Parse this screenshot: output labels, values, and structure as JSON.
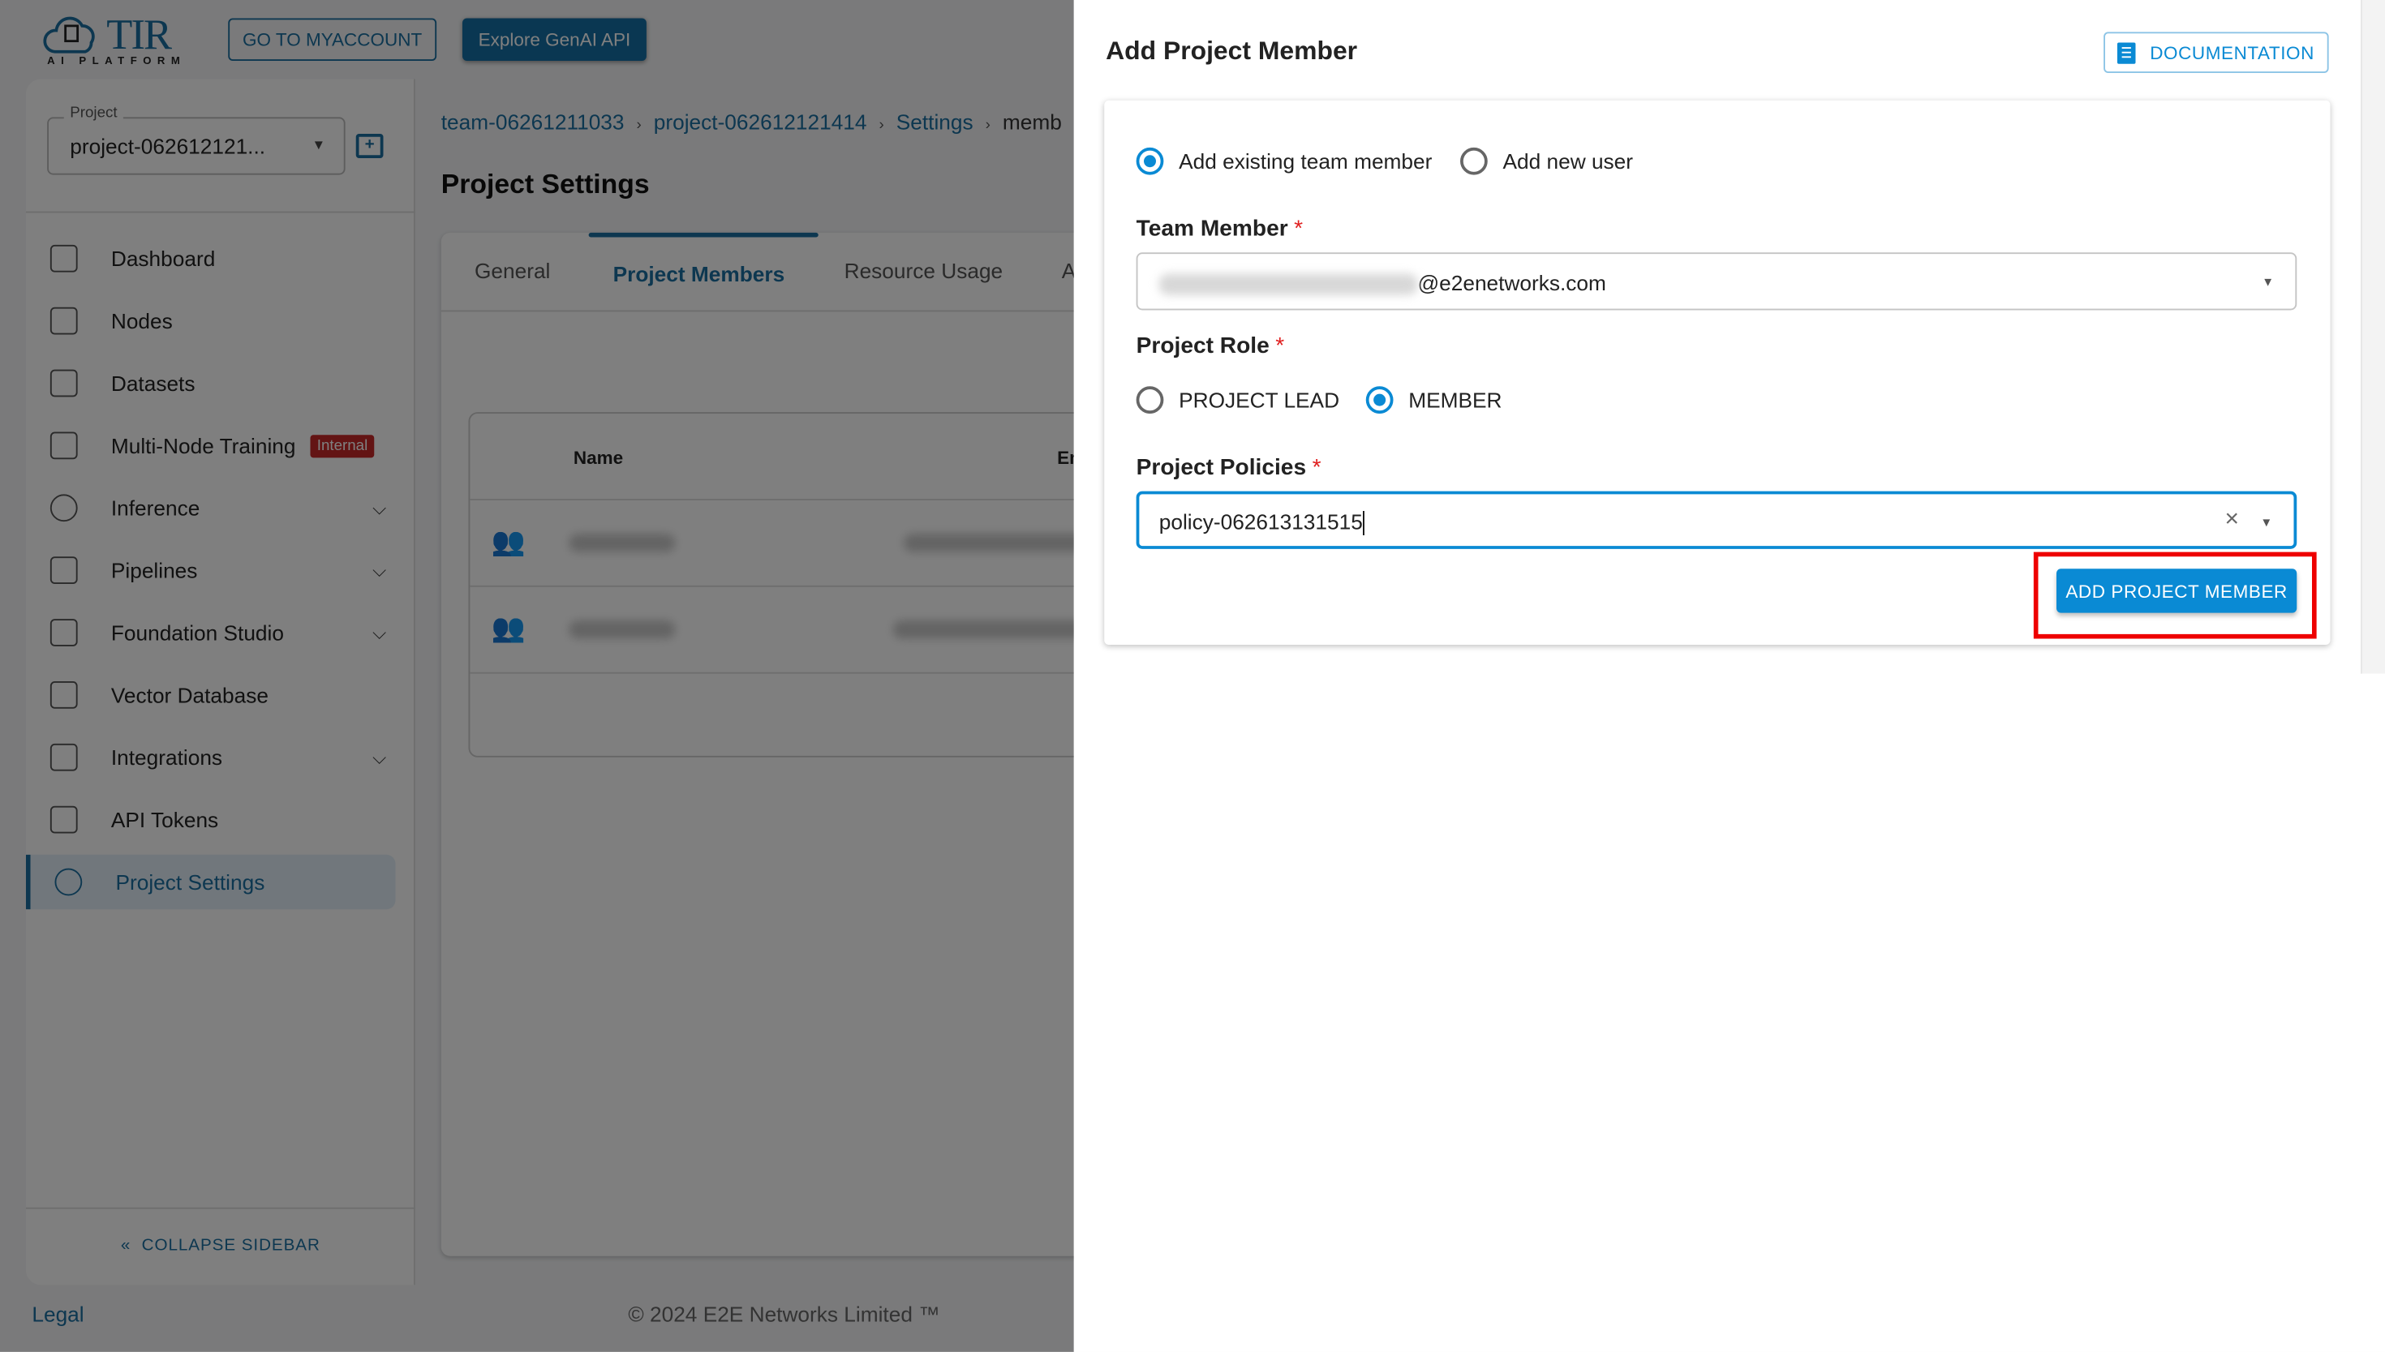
{
  "header": {
    "logo_text": "TIR",
    "logo_sub": "AI PLATFORM",
    "myaccount_label": "GO TO MYACCOUNT",
    "genai_label": "Explore GenAI API"
  },
  "sidebar": {
    "project_label": "Project",
    "project_value": "project-062612121...",
    "items": [
      {
        "label": "Dashboard",
        "icon": "dashboard-icon"
      },
      {
        "label": "Nodes",
        "icon": "file-icon"
      },
      {
        "label": "Datasets",
        "icon": "dataset-icon"
      },
      {
        "label": "Multi-Node Training",
        "icon": "training-icon",
        "badge": "Internal"
      },
      {
        "label": "Inference",
        "icon": "inference-icon",
        "expandable": true
      },
      {
        "label": "Pipelines",
        "icon": "pipeline-icon",
        "expandable": true
      },
      {
        "label": "Foundation Studio",
        "icon": "studio-icon",
        "expandable": true
      },
      {
        "label": "Vector Database",
        "icon": "vector-icon"
      },
      {
        "label": "Integrations",
        "icon": "integration-icon",
        "expandable": true
      },
      {
        "label": "API Tokens",
        "icon": "token-icon"
      },
      {
        "label": "Project Settings",
        "icon": "gear-icon",
        "active": true
      }
    ],
    "collapse_label": "COLLAPSE SIDEBAR"
  },
  "breadcrumb": [
    "team-06261211033",
    "project-062612121414",
    "Settings",
    "memb"
  ],
  "page_title": "Project Settings",
  "tabs": [
    {
      "label": "General"
    },
    {
      "label": "Project Members",
      "active": true
    },
    {
      "label": "Resource Usage"
    },
    {
      "label": "A"
    }
  ],
  "table": {
    "columns": [
      "Name",
      "Em"
    ]
  },
  "footer": {
    "legal": "Legal",
    "copyright": "© 2024 E2E Networks Limited ™"
  },
  "dialog": {
    "title": "Add Project Member",
    "doc_label": "DOCUMENTATION",
    "mode_options": [
      {
        "label": "Add existing team member",
        "selected": true
      },
      {
        "label": "Add new user",
        "selected": false
      }
    ],
    "team_member_label": "Team Member",
    "team_member_value": "@e2enetworks.com",
    "role_label": "Project Role",
    "role_options": [
      {
        "label": "PROJECT LEAD",
        "selected": false
      },
      {
        "label": "MEMBER",
        "selected": true
      }
    ],
    "policies_label": "Project Policies",
    "policies_value": "policy-062613131515",
    "required_mark": "*",
    "submit_label": "ADD PROJECT MEMBER"
  },
  "colors": {
    "primary": "#1a6fa0",
    "accent": "#0a8ad4",
    "highlight": "#ee0000"
  }
}
